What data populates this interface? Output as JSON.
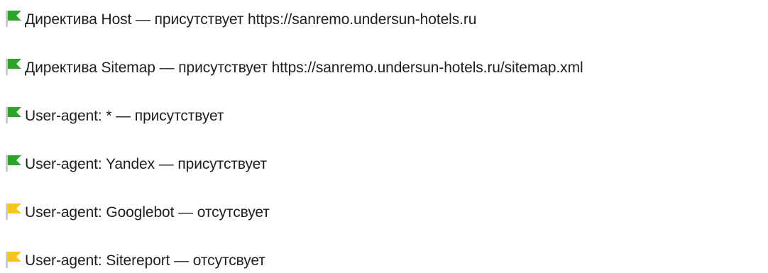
{
  "colors": {
    "ok_flag": "#2aa52a",
    "warn_flag": "#f5c518",
    "pole": "#c9c9c9",
    "text": "#1f1f1f"
  },
  "items": [
    {
      "status": "ok",
      "icon": "green-flag-icon",
      "text": "Директива Host — присутствует https://sanremo.undersun-hotels.ru"
    },
    {
      "status": "ok",
      "icon": "green-flag-icon",
      "text": "Директива Sitemap — присутствует https://sanremo.undersun-hotels.ru/sitemap.xml"
    },
    {
      "status": "ok",
      "icon": "green-flag-icon",
      "text": "User-agent: * — присутствует"
    },
    {
      "status": "ok",
      "icon": "green-flag-icon",
      "text": "User-agent: Yandex — присутствует"
    },
    {
      "status": "warn",
      "icon": "yellow-flag-icon",
      "text": "User-agent: Googlebot — отсутсвует"
    },
    {
      "status": "warn",
      "icon": "yellow-flag-icon",
      "text": "User-agent: Sitereport — отсутсвует"
    }
  ]
}
